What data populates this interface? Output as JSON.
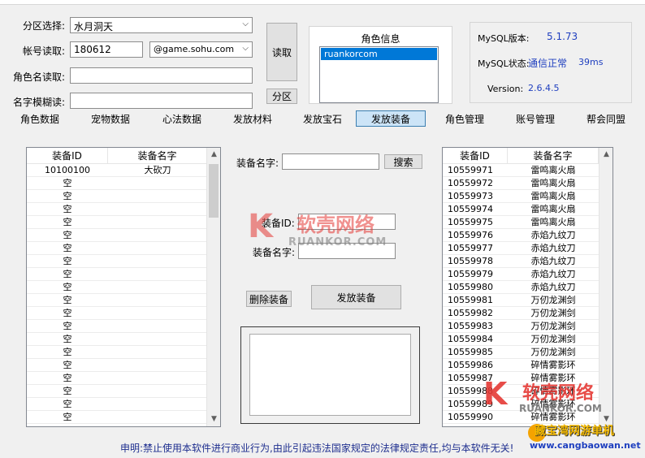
{
  "left_form": {
    "zone_label": "分区选择:",
    "zone_value": "水月洞天",
    "account_label": "帐号读取:",
    "account_value": "180612",
    "domain_value": "@game.sohu.com",
    "role_label": "角色名读取:",
    "role_value": "",
    "fuzzy_label": "名字模糊读:",
    "fuzzy_value": "",
    "read_button": "读取",
    "zone_button": "分区"
  },
  "role_info": {
    "title": "角色信息",
    "selected_item": "ruankorcom"
  },
  "mysql": {
    "version_label": "MySQL版本:",
    "version_value": "5.1.73",
    "status_label": "MySQL状态:",
    "status_value": "通信正常",
    "latency": "39ms",
    "version2_label": "Version:",
    "version2_value": "2.6.4.5"
  },
  "tabs": [
    "角色数据",
    "宠物数据",
    "心法数据",
    "发放材料",
    "发放宝石",
    "发放装备",
    "角色管理",
    "账号管理",
    "帮会同盟"
  ],
  "active_tab": "发放装备",
  "left_list": {
    "col1": "装备ID",
    "col2": "装备名字",
    "first_id": "10100100",
    "first_name": "大砍刀",
    "empty_label": "空",
    "empty_count": 19
  },
  "center": {
    "search_label": "装备名字:",
    "search_value": "",
    "search_button": "搜索",
    "id_label": "装备ID:",
    "id_value": "",
    "name_label": "装备名字:",
    "name_value": "",
    "delete_button": "删除装备",
    "issue_button": "发放装备"
  },
  "right_list": {
    "col1": "装备ID",
    "col2": "装备名字",
    "rows": [
      {
        "id": "10559971",
        "name": "雷鸣离火扇"
      },
      {
        "id": "10559972",
        "name": "雷鸣离火扇"
      },
      {
        "id": "10559973",
        "name": "雷鸣离火扇"
      },
      {
        "id": "10559974",
        "name": "雷鸣离火扇"
      },
      {
        "id": "10559975",
        "name": "雷鸣离火扇"
      },
      {
        "id": "10559976",
        "name": "赤焰九纹刀"
      },
      {
        "id": "10559977",
        "name": "赤焰九纹刀"
      },
      {
        "id": "10559978",
        "name": "赤焰九纹刀"
      },
      {
        "id": "10559979",
        "name": "赤焰九纹刀"
      },
      {
        "id": "10559980",
        "name": "赤焰九纹刀"
      },
      {
        "id": "10559981",
        "name": "万仞龙渊剑"
      },
      {
        "id": "10559982",
        "name": "万仞龙渊剑"
      },
      {
        "id": "10559983",
        "name": "万仞龙渊剑"
      },
      {
        "id": "10559984",
        "name": "万仞龙渊剑"
      },
      {
        "id": "10559985",
        "name": "万仞龙渊剑"
      },
      {
        "id": "10559986",
        "name": "碎情雾影环"
      },
      {
        "id": "10559987",
        "name": "碎情雾影环"
      },
      {
        "id": "10559988",
        "name": "碎情雾影环"
      },
      {
        "id": "10559989",
        "name": "碎情雾影环"
      },
      {
        "id": "10559990",
        "name": "碎情雾影环"
      }
    ]
  },
  "footer": "申明:禁止使用本软件进行商业行为,由此引起违法国家规定的法律规定责任,均与本软件无关!",
  "watermark": {
    "brand": "软壳网络",
    "domain": "RUANKOR.COM",
    "corner_text": "藏宝湾网游单机",
    "corner_url": "www.cangbaowan.net"
  },
  "colors": {
    "mysql_value": "#1f3fbf",
    "watermark_red": "#e53935",
    "active_tab_bg": "#cce4f7",
    "footer_text": "#1f2f8f",
    "selected_item_bg": "#0078d7"
  }
}
